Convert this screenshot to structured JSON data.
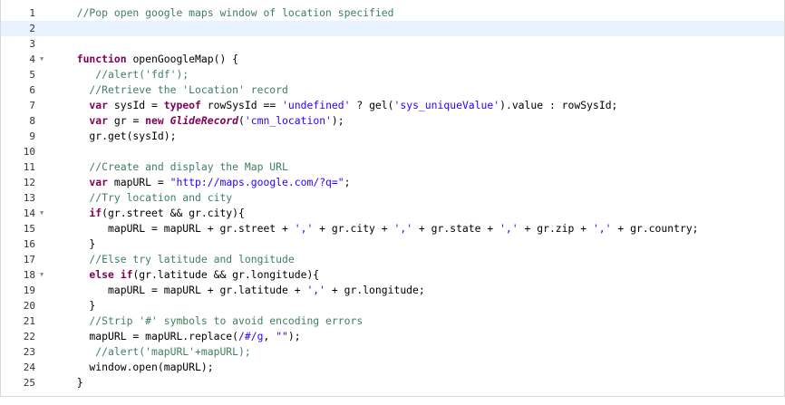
{
  "editor": {
    "language": "javascript",
    "active_line": 2,
    "fold_markers": [
      4,
      14,
      18
    ],
    "lines": [
      {
        "n": "1",
        "tokens": [
          {
            "t": "cm",
            "v": "  //Pop open google maps window of location specified"
          }
        ]
      },
      {
        "n": "2",
        "tokens": []
      },
      {
        "n": "3",
        "tokens": []
      },
      {
        "n": "4",
        "tokens": [
          {
            "t": "kw",
            "v": "  function "
          },
          {
            "t": "ident",
            "v": "openGoogleMap() {"
          }
        ]
      },
      {
        "n": "5",
        "tokens": [
          {
            "t": "cm",
            "v": "     //alert('fdf');"
          }
        ]
      },
      {
        "n": "6",
        "tokens": [
          {
            "t": "cm",
            "v": "    //Retrieve the 'Location' record"
          }
        ]
      },
      {
        "n": "7",
        "tokens": [
          {
            "t": "kw",
            "v": "    var "
          },
          {
            "t": "ident",
            "v": "sysId = "
          },
          {
            "t": "kw",
            "v": "typeof "
          },
          {
            "t": "ident",
            "v": "rowSysId == "
          },
          {
            "t": "st",
            "v": "'undefined'"
          },
          {
            "t": "ident",
            "v": " ? gel("
          },
          {
            "t": "st",
            "v": "'sys_uniqueValue'"
          },
          {
            "t": "ident",
            "v": ").value : rowSysId;"
          }
        ]
      },
      {
        "n": "8",
        "tokens": [
          {
            "t": "kw",
            "v": "    var "
          },
          {
            "t": "ident",
            "v": "gr = "
          },
          {
            "t": "kw",
            "v": "new "
          },
          {
            "t": "cls",
            "v": "GlideRecord"
          },
          {
            "t": "ident",
            "v": "("
          },
          {
            "t": "st",
            "v": "'cmn_location'"
          },
          {
            "t": "ident",
            "v": ");"
          }
        ]
      },
      {
        "n": "9",
        "tokens": [
          {
            "t": "ident",
            "v": "    gr.get(sysId);"
          }
        ]
      },
      {
        "n": "10",
        "tokens": []
      },
      {
        "n": "11",
        "tokens": [
          {
            "t": "cm",
            "v": "    //Create and display the Map URL"
          }
        ]
      },
      {
        "n": "12",
        "tokens": [
          {
            "t": "kw",
            "v": "    var "
          },
          {
            "t": "ident",
            "v": "mapURL = "
          },
          {
            "t": "st",
            "v": "\"http://maps.google.com/?q=\""
          },
          {
            "t": "ident",
            "v": ";"
          }
        ]
      },
      {
        "n": "13",
        "tokens": [
          {
            "t": "cm",
            "v": "    //Try location and city"
          }
        ]
      },
      {
        "n": "14",
        "tokens": [
          {
            "t": "kw",
            "v": "    if"
          },
          {
            "t": "ident",
            "v": "(gr.street && gr.city){"
          }
        ]
      },
      {
        "n": "15",
        "tokens": [
          {
            "t": "ident",
            "v": "       mapURL = mapURL + gr.street + "
          },
          {
            "t": "st",
            "v": "','"
          },
          {
            "t": "ident",
            "v": " + gr.city + "
          },
          {
            "t": "st",
            "v": "','"
          },
          {
            "t": "ident",
            "v": " + gr.state + "
          },
          {
            "t": "st",
            "v": "','"
          },
          {
            "t": "ident",
            "v": " + gr.zip + "
          },
          {
            "t": "st",
            "v": "','"
          },
          {
            "t": "ident",
            "v": " + gr.country;"
          }
        ]
      },
      {
        "n": "16",
        "tokens": [
          {
            "t": "ident",
            "v": "    }"
          }
        ]
      },
      {
        "n": "17",
        "tokens": [
          {
            "t": "cm",
            "v": "    //Else try latitude and longitude"
          }
        ]
      },
      {
        "n": "18",
        "tokens": [
          {
            "t": "kw",
            "v": "    else if"
          },
          {
            "t": "ident",
            "v": "(gr.latitude && gr.longitude){"
          }
        ]
      },
      {
        "n": "19",
        "tokens": [
          {
            "t": "ident",
            "v": "       mapURL = mapURL + gr.latitude + "
          },
          {
            "t": "st",
            "v": "','"
          },
          {
            "t": "ident",
            "v": " + gr.longitude;"
          }
        ]
      },
      {
        "n": "20",
        "tokens": [
          {
            "t": "ident",
            "v": "    }"
          }
        ]
      },
      {
        "n": "21",
        "tokens": [
          {
            "t": "cm",
            "v": "    //Strip '#' symbols to avoid encoding errors"
          }
        ]
      },
      {
        "n": "22",
        "tokens": [
          {
            "t": "ident",
            "v": "    mapURL = mapURL.replace("
          },
          {
            "t": "rx",
            "v": "/#/g"
          },
          {
            "t": "ident",
            "v": ", "
          },
          {
            "t": "st",
            "v": "\"\""
          },
          {
            "t": "ident",
            "v": ");"
          }
        ]
      },
      {
        "n": "23",
        "tokens": [
          {
            "t": "cm",
            "v": "     //alert('mapURL'+mapURL);"
          }
        ]
      },
      {
        "n": "24",
        "tokens": [
          {
            "t": "ident",
            "v": "    window.open(mapURL);"
          }
        ]
      },
      {
        "n": "25",
        "tokens": [
          {
            "t": "ident",
            "v": "  }"
          }
        ]
      }
    ]
  }
}
